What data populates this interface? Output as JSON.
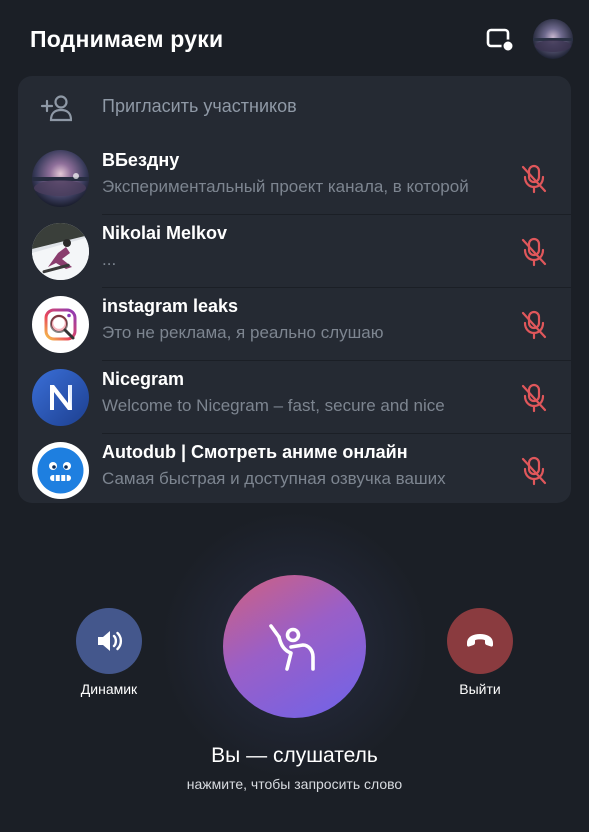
{
  "header": {
    "title": "Поднимаем руки",
    "screen_icon": "screen-share-icon",
    "avatar_icon": "account-avatar"
  },
  "invite": {
    "label": "Пригласить участников",
    "icon": "add-user-icon"
  },
  "participants": [
    {
      "name": "ВБездну",
      "status": "Экспериментальный проект канала, в которой",
      "muted": true
    },
    {
      "name": "Nikolai Melkov",
      "status": "...",
      "muted": true
    },
    {
      "name": "instagram leaks",
      "status": "Это не реклама, я реально слушаю",
      "muted": true
    },
    {
      "name": "Nicegram",
      "status": "Welcome to Nicegram – fast, secure and nice",
      "muted": true
    },
    {
      "name": "Autodub | Смотреть аниме онлайн",
      "status": "Самая быстрая и доступная озвучка ваших",
      "muted": true
    }
  ],
  "controls": {
    "speaker_label": "Динамик",
    "leave_label": "Выйти",
    "raise_hand_icon": "raise-hand-icon"
  },
  "status": {
    "role": "Вы — слушатель",
    "hint": "нажмите, чтобы запросить слово"
  },
  "colors": {
    "background": "#1b1f26",
    "panel": "#252a33",
    "muted_mic": "#e0575b",
    "speaker_button": "#44578c",
    "leave_button": "#8a3b3f",
    "main_gradient_start": "#d0607e",
    "main_gradient_end": "#6e63ea"
  }
}
